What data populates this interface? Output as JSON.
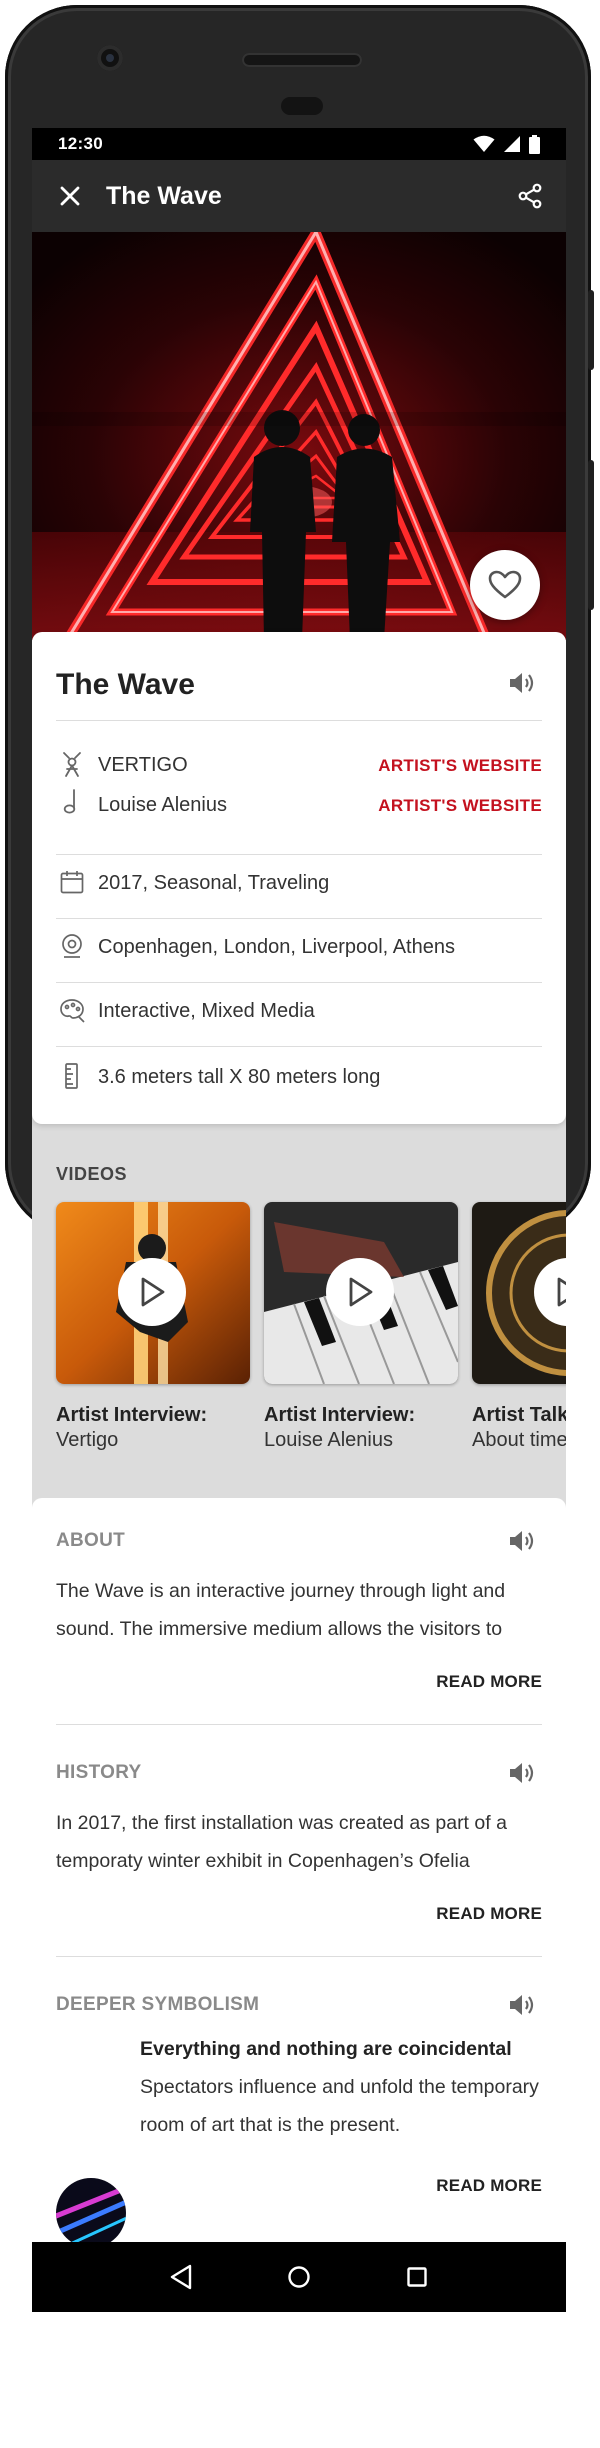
{
  "status": {
    "time": "12:30"
  },
  "app_bar": {
    "title": "The Wave",
    "close_icon": "close-icon",
    "share_icon": "share-icon"
  },
  "hero": {
    "favorite_icon": "heart-outline-icon"
  },
  "info": {
    "title": "The Wave",
    "credits": [
      {
        "icon": "artist-figure-icon",
        "name": "VERTIGO",
        "link": "ARTIST'S WEBSITE"
      },
      {
        "icon": "music-note-icon",
        "name": "Louise Alenius",
        "link": "ARTIST'S WEBSITE"
      }
    ],
    "details": [
      {
        "icon": "calendar-icon",
        "text": "2017, Seasonal, Traveling"
      },
      {
        "icon": "location-icon",
        "text": "Copenhagen, London, Liverpool, Athens"
      },
      {
        "icon": "palette-icon",
        "text": "Interactive, Mixed Media"
      },
      {
        "icon": "ruler-icon",
        "text": "3.6 meters tall X 80 meters long"
      }
    ]
  },
  "videos": {
    "label": "VIDEOS",
    "items": [
      {
        "title": "Artist Interview:",
        "subtitle": "Vertigo"
      },
      {
        "title": "Artist Interview:",
        "subtitle": "Louise Alenius"
      },
      {
        "title": "Artist Talk",
        "subtitle": "About time"
      }
    ]
  },
  "sections": {
    "about": {
      "heading": "ABOUT",
      "body": "The Wave is an interactive journey through light and sound. The immersive medium allows the visitors to",
      "read_more": "READ MORE"
    },
    "history": {
      "heading": "HISTORY",
      "body": "In 2017, the first installation was created as part of a temporaty winter exhibit in Copenhagen’s Ofelia",
      "read_more": "READ MORE"
    },
    "symbolism": {
      "heading": "DEEPER SYMBOLISM",
      "title": "Everything and nothing are coincidental",
      "body": "Spectators  influence and unfold the temporary room of art that is the present.",
      "read_more": "READ MORE"
    }
  },
  "colors": {
    "accent": "#c4121f",
    "app_bar": "#2b2b2b",
    "neon": "#ff2a2a"
  }
}
